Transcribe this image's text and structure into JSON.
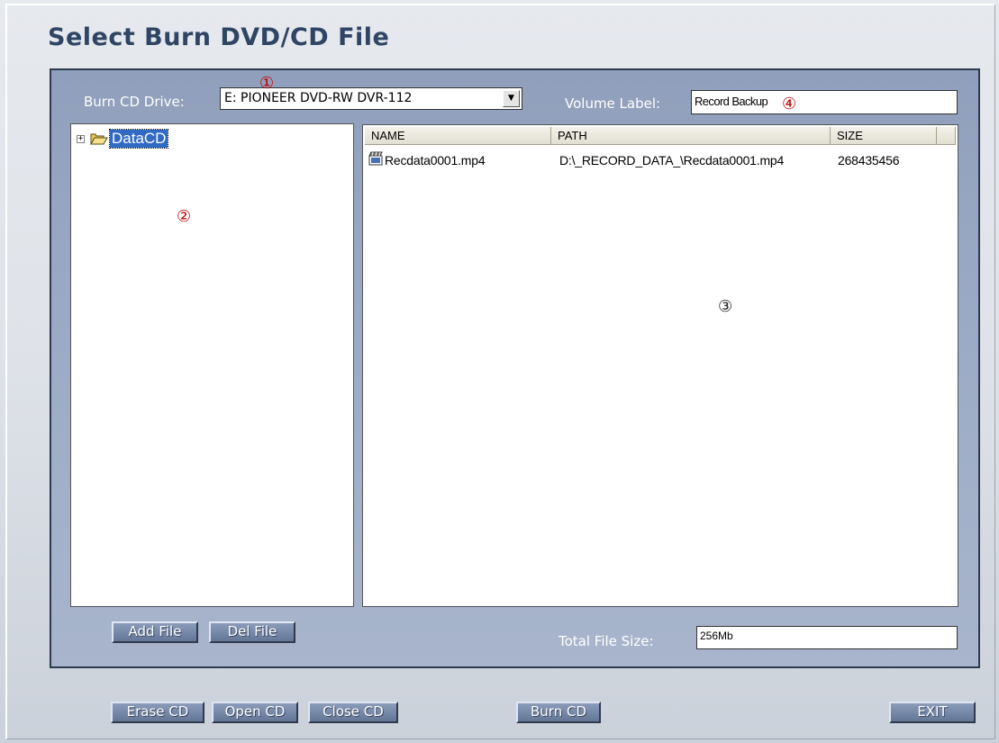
{
  "window": {
    "title": "Select Burn DVD/CD File"
  },
  "drive": {
    "label": "Burn CD Drive:",
    "selected": "E: PIONEER DVD-RW DVR-112",
    "dropdown_glyph": "▼"
  },
  "volume": {
    "label": "Volume Label:",
    "value": "Record Backup"
  },
  "tree": {
    "expander_glyph": "+",
    "root_label": "DataCD"
  },
  "file_list": {
    "columns": [
      "NAME",
      "PATH",
      "SIZE"
    ],
    "rows": [
      {
        "name": "Recdata0001.mp4",
        "path": "D:\\_RECORD_DATA_\\Recdata0001.mp4",
        "size": "268435456"
      }
    ]
  },
  "buttons": {
    "add_file": "Add File",
    "del_file": "Del File",
    "erase_cd": "Erase CD",
    "open_cd": "Open CD",
    "close_cd": "Close CD",
    "burn_cd": "Burn CD",
    "exit": "EXIT"
  },
  "total_size": {
    "label": "Total File Size:",
    "value": "256Mb"
  },
  "markers": {
    "m1": "①",
    "m2": "②",
    "m3": "③",
    "m4": "④"
  }
}
